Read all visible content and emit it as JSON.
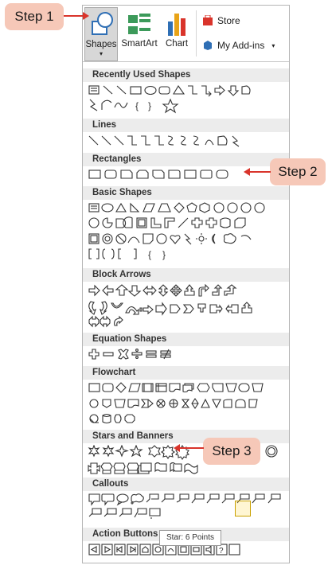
{
  "ribbon": {
    "shapes_label": "Shapes",
    "smartart_label": "SmartArt",
    "chart_label": "Chart",
    "store_label": "Store",
    "addins_label": "My Add-ins"
  },
  "categories": [
    {
      "label": "Recently Used Shapes"
    },
    {
      "label": "Lines"
    },
    {
      "label": "Rectangles"
    },
    {
      "label": "Basic Shapes"
    },
    {
      "label": "Block Arrows"
    },
    {
      "label": "Equation Shapes"
    },
    {
      "label": "Flowchart"
    },
    {
      "label": "Stars and Banners"
    },
    {
      "label": "Callouts"
    },
    {
      "label": "Action Buttons"
    }
  ],
  "tooltip": "Star: 6 Points",
  "steps": [
    {
      "label": "Step 1"
    },
    {
      "label": "Step 2"
    },
    {
      "label": "Step 3"
    }
  ],
  "colors": {
    "callout": "#f6c8b8",
    "arrow": "#d9342b",
    "category_bg": "#ececec"
  }
}
